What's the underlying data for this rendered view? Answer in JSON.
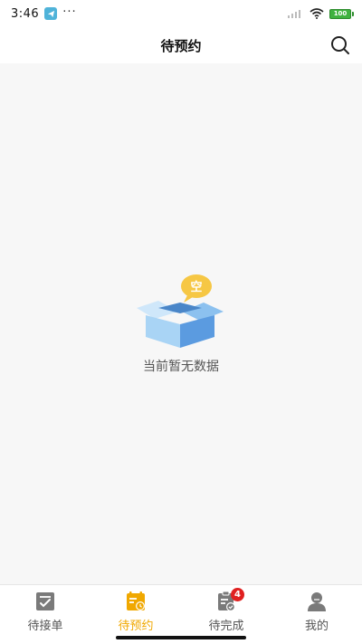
{
  "status_bar": {
    "time": "3:46",
    "more": "···",
    "battery": "100"
  },
  "header": {
    "title": "待预约",
    "search_icon": "search-icon"
  },
  "empty_state": {
    "badge_char": "空",
    "message": "当前暂无数据",
    "icon": "empty-box-icon"
  },
  "tabbar": {
    "tabs": [
      {
        "label": "待接单",
        "icon": "order-check-icon",
        "active": false
      },
      {
        "label": "待预约",
        "icon": "calendar-clock-icon",
        "active": true
      },
      {
        "label": "待完成",
        "icon": "clipboard-check-icon",
        "active": false,
        "badge": "4"
      },
      {
        "label": "我的",
        "icon": "user-icon",
        "active": false
      }
    ]
  },
  "colors": {
    "accent": "#f0a800",
    "inactive_icon": "#7a7a7a",
    "badge": "#e02020",
    "box_light": "#a9d4f5",
    "box_dark": "#5b9be0",
    "bubble": "#f6c744"
  }
}
